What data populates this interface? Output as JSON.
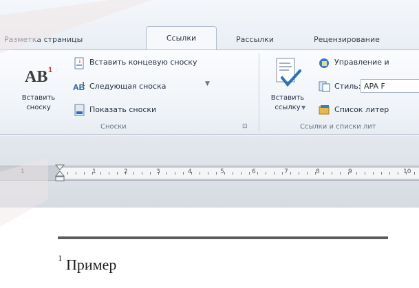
{
  "tabs": [
    "Разметка страницы",
    "Ссылки",
    "Рассылки",
    "Рецензирование"
  ],
  "active_tab": "Ссылки",
  "ribbon": {
    "footnotes_group": {
      "insert_footnote": [
        "Вставить",
        "сноску"
      ],
      "insert_endnote": "Вставить концевую сноску",
      "next_footnote": "Следующая сноска",
      "show_notes": "Показать сноски",
      "title": "Сноски"
    },
    "citations_group": {
      "insert_citation": [
        "Вставить",
        "ссылку"
      ],
      "manage_sources": "Управление и",
      "style_label": "Стиль:",
      "style_value": "APA F",
      "bibliography": "Список литер",
      "title": "Ссылки и списки лит"
    }
  },
  "ruler": {
    "numbers": [
      "1",
      "1",
      "2",
      "3",
      "4",
      "5",
      "6",
      "7",
      "8",
      "9",
      "10"
    ]
  },
  "document": {
    "footnote_number": "1",
    "footnote_text": "Пример"
  },
  "colors": {
    "ribbon_bg": "#eef2f7",
    "watermark": "#f1e6e6",
    "doc_bg": "#ffffff"
  }
}
